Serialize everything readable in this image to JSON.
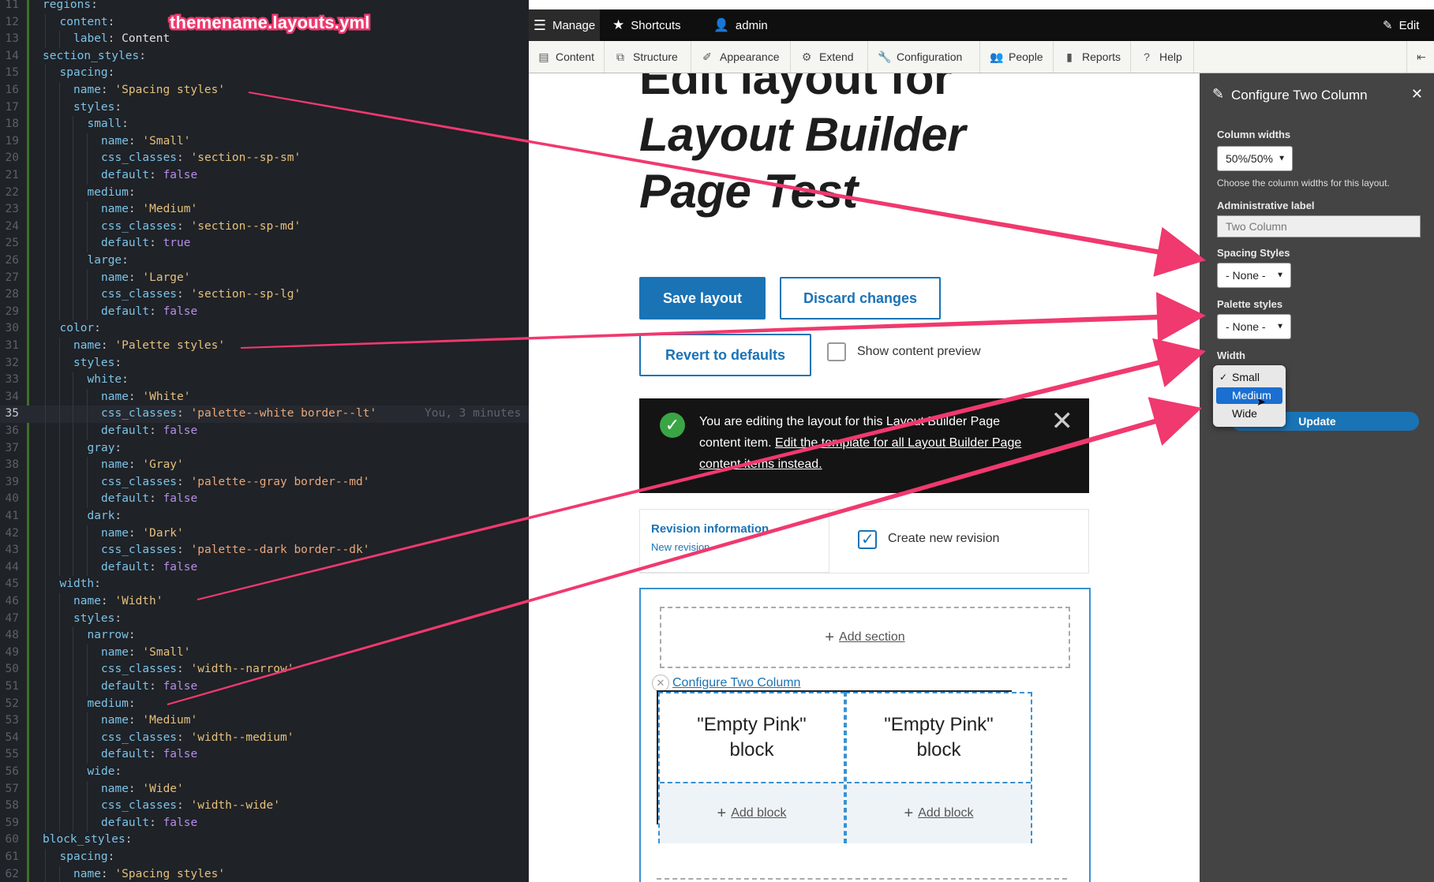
{
  "editor": {
    "file_label": "themename.layouts.yml",
    "blame": "You, 3 minutes",
    "lines": [
      {
        "n": "11",
        "indent": 1,
        "parts": [
          [
            "k",
            "regions"
          ],
          [
            "p",
            ":"
          ]
        ]
      },
      {
        "n": "12",
        "indent": 2,
        "parts": [
          [
            "k",
            "content"
          ],
          [
            "p",
            ":"
          ]
        ]
      },
      {
        "n": "13",
        "indent": 3,
        "parts": [
          [
            "k",
            "label"
          ],
          [
            "p",
            ": "
          ],
          [
            "t",
            "Content"
          ]
        ]
      },
      {
        "n": "14",
        "indent": 1,
        "parts": [
          [
            "k",
            "section_styles"
          ],
          [
            "p",
            ":"
          ]
        ]
      },
      {
        "n": "15",
        "indent": 2,
        "parts": [
          [
            "k",
            "spacing"
          ],
          [
            "p",
            ":"
          ]
        ]
      },
      {
        "n": "16",
        "indent": 3,
        "parts": [
          [
            "k",
            "name"
          ],
          [
            "p",
            ": "
          ],
          [
            "s",
            "'Spacing styles'"
          ]
        ]
      },
      {
        "n": "17",
        "indent": 3,
        "parts": [
          [
            "k",
            "styles"
          ],
          [
            "p",
            ":"
          ]
        ]
      },
      {
        "n": "18",
        "indent": 4,
        "parts": [
          [
            "k",
            "small"
          ],
          [
            "p",
            ":"
          ]
        ]
      },
      {
        "n": "19",
        "indent": 5,
        "parts": [
          [
            "k",
            "name"
          ],
          [
            "p",
            ": "
          ],
          [
            "s",
            "'Small'"
          ]
        ]
      },
      {
        "n": "20",
        "indent": 5,
        "parts": [
          [
            "k",
            "css_classes"
          ],
          [
            "p",
            ": "
          ],
          [
            "s",
            "'section--sp-sm'"
          ]
        ]
      },
      {
        "n": "21",
        "indent": 5,
        "parts": [
          [
            "k",
            "default"
          ],
          [
            "p",
            ": "
          ],
          [
            "b",
            "false"
          ]
        ]
      },
      {
        "n": "22",
        "indent": 4,
        "parts": [
          [
            "k",
            "medium"
          ],
          [
            "p",
            ":"
          ]
        ]
      },
      {
        "n": "23",
        "indent": 5,
        "parts": [
          [
            "k",
            "name"
          ],
          [
            "p",
            ": "
          ],
          [
            "s",
            "'Medium'"
          ]
        ]
      },
      {
        "n": "24",
        "indent": 5,
        "parts": [
          [
            "k",
            "css_classes"
          ],
          [
            "p",
            ": "
          ],
          [
            "s",
            "'section--sp-md'"
          ]
        ]
      },
      {
        "n": "25",
        "indent": 5,
        "parts": [
          [
            "k",
            "default"
          ],
          [
            "p",
            ": "
          ],
          [
            "b",
            "true"
          ]
        ]
      },
      {
        "n": "26",
        "indent": 4,
        "parts": [
          [
            "k",
            "large"
          ],
          [
            "p",
            ":"
          ]
        ]
      },
      {
        "n": "27",
        "indent": 5,
        "parts": [
          [
            "k",
            "name"
          ],
          [
            "p",
            ": "
          ],
          [
            "s",
            "'Large'"
          ]
        ]
      },
      {
        "n": "28",
        "indent": 5,
        "parts": [
          [
            "k",
            "css_classes"
          ],
          [
            "p",
            ": "
          ],
          [
            "s",
            "'section--sp-lg'"
          ]
        ]
      },
      {
        "n": "29",
        "indent": 5,
        "parts": [
          [
            "k",
            "default"
          ],
          [
            "p",
            ": "
          ],
          [
            "b",
            "false"
          ]
        ]
      },
      {
        "n": "30",
        "indent": 2,
        "parts": [
          [
            "k",
            "color"
          ],
          [
            "p",
            ":"
          ]
        ]
      },
      {
        "n": "31",
        "indent": 3,
        "parts": [
          [
            "k",
            "name"
          ],
          [
            "p",
            ": "
          ],
          [
            "s",
            "'Palette styles'"
          ]
        ]
      },
      {
        "n": "32",
        "indent": 3,
        "parts": [
          [
            "k",
            "styles"
          ],
          [
            "p",
            ":"
          ]
        ]
      },
      {
        "n": "33",
        "indent": 4,
        "parts": [
          [
            "k",
            "white"
          ],
          [
            "p",
            ":"
          ]
        ]
      },
      {
        "n": "34",
        "indent": 5,
        "parts": [
          [
            "k",
            "name"
          ],
          [
            "p",
            ": "
          ],
          [
            "s",
            "'White'"
          ]
        ]
      },
      {
        "n": "35",
        "indent": 5,
        "parts": [
          [
            "k",
            "css_classes"
          ],
          [
            "p",
            ": "
          ],
          [
            "s",
            "'"
          ],
          [
            "sv",
            "palette--white border--lt"
          ],
          [
            "s",
            "'"
          ]
        ]
      },
      {
        "n": "36",
        "indent": 5,
        "parts": [
          [
            "k",
            "default"
          ],
          [
            "p",
            ": "
          ],
          [
            "b",
            "false"
          ]
        ]
      },
      {
        "n": "37",
        "indent": 4,
        "parts": [
          [
            "k",
            "gray"
          ],
          [
            "p",
            ":"
          ]
        ]
      },
      {
        "n": "38",
        "indent": 5,
        "parts": [
          [
            "k",
            "name"
          ],
          [
            "p",
            ": "
          ],
          [
            "s",
            "'Gray'"
          ]
        ]
      },
      {
        "n": "39",
        "indent": 5,
        "parts": [
          [
            "k",
            "css_classes"
          ],
          [
            "p",
            ": "
          ],
          [
            "s",
            "'"
          ],
          [
            "sv",
            "palette--gray border--md"
          ],
          [
            "s",
            "'"
          ]
        ]
      },
      {
        "n": "40",
        "indent": 5,
        "parts": [
          [
            "k",
            "default"
          ],
          [
            "p",
            ": "
          ],
          [
            "b",
            "false"
          ]
        ]
      },
      {
        "n": "41",
        "indent": 4,
        "parts": [
          [
            "k",
            "dark"
          ],
          [
            "p",
            ":"
          ]
        ]
      },
      {
        "n": "42",
        "indent": 5,
        "parts": [
          [
            "k",
            "name"
          ],
          [
            "p",
            ": "
          ],
          [
            "s",
            "'Dark'"
          ]
        ]
      },
      {
        "n": "43",
        "indent": 5,
        "parts": [
          [
            "k",
            "css_classes"
          ],
          [
            "p",
            ": "
          ],
          [
            "s",
            "'"
          ],
          [
            "sv",
            "palette--dark border--dk"
          ],
          [
            "s",
            "'"
          ]
        ]
      },
      {
        "n": "44",
        "indent": 5,
        "parts": [
          [
            "k",
            "default"
          ],
          [
            "p",
            ": "
          ],
          [
            "b",
            "false"
          ]
        ]
      },
      {
        "n": "45",
        "indent": 2,
        "parts": [
          [
            "k",
            "width"
          ],
          [
            "p",
            ":"
          ]
        ]
      },
      {
        "n": "46",
        "indent": 3,
        "parts": [
          [
            "k",
            "name"
          ],
          [
            "p",
            ": "
          ],
          [
            "s",
            "'Width'"
          ]
        ]
      },
      {
        "n": "47",
        "indent": 3,
        "parts": [
          [
            "k",
            "styles"
          ],
          [
            "p",
            ":"
          ]
        ]
      },
      {
        "n": "48",
        "indent": 4,
        "parts": [
          [
            "k",
            "narrow"
          ],
          [
            "p",
            ":"
          ]
        ]
      },
      {
        "n": "49",
        "indent": 5,
        "parts": [
          [
            "k",
            "name"
          ],
          [
            "p",
            ": "
          ],
          [
            "s",
            "'Small'"
          ]
        ]
      },
      {
        "n": "50",
        "indent": 5,
        "parts": [
          [
            "k",
            "css_classes"
          ],
          [
            "p",
            ": "
          ],
          [
            "s",
            "'width--narrow'"
          ]
        ]
      },
      {
        "n": "51",
        "indent": 5,
        "parts": [
          [
            "k",
            "default"
          ],
          [
            "p",
            ": "
          ],
          [
            "b",
            "false"
          ]
        ]
      },
      {
        "n": "52",
        "indent": 4,
        "parts": [
          [
            "k",
            "medium"
          ],
          [
            "p",
            ":"
          ]
        ]
      },
      {
        "n": "53",
        "indent": 5,
        "parts": [
          [
            "k",
            "name"
          ],
          [
            "p",
            ": "
          ],
          [
            "s",
            "'Medium'"
          ]
        ]
      },
      {
        "n": "54",
        "indent": 5,
        "parts": [
          [
            "k",
            "css_classes"
          ],
          [
            "p",
            ": "
          ],
          [
            "s",
            "'width--medium'"
          ]
        ]
      },
      {
        "n": "55",
        "indent": 5,
        "parts": [
          [
            "k",
            "default"
          ],
          [
            "p",
            ": "
          ],
          [
            "b",
            "false"
          ]
        ]
      },
      {
        "n": "56",
        "indent": 4,
        "parts": [
          [
            "k",
            "wide"
          ],
          [
            "p",
            ":"
          ]
        ]
      },
      {
        "n": "57",
        "indent": 5,
        "parts": [
          [
            "k",
            "name"
          ],
          [
            "p",
            ": "
          ],
          [
            "s",
            "'Wide'"
          ]
        ]
      },
      {
        "n": "58",
        "indent": 5,
        "parts": [
          [
            "k",
            "css_classes"
          ],
          [
            "p",
            ": "
          ],
          [
            "s",
            "'width--wide'"
          ]
        ]
      },
      {
        "n": "59",
        "indent": 5,
        "parts": [
          [
            "k",
            "default"
          ],
          [
            "p",
            ": "
          ],
          [
            "b",
            "false"
          ]
        ]
      },
      {
        "n": "60",
        "indent": 1,
        "parts": [
          [
            "k",
            "block_styles"
          ],
          [
            "p",
            ":"
          ]
        ]
      },
      {
        "n": "61",
        "indent": 2,
        "parts": [
          [
            "k",
            "spacing"
          ],
          [
            "p",
            ":"
          ]
        ]
      },
      {
        "n": "62",
        "indent": 3,
        "parts": [
          [
            "k",
            "name"
          ],
          [
            "p",
            ": "
          ],
          [
            "s",
            "'Spacing styles'"
          ]
        ]
      }
    ]
  },
  "toolbar": {
    "manage": "Manage",
    "shortcuts": "Shortcuts",
    "user": "admin",
    "edit": "Edit",
    "tray": [
      "Content",
      "Structure",
      "Appearance",
      "Extend",
      "Configuration",
      "People",
      "Reports",
      "Help"
    ]
  },
  "page": {
    "title_line1": "Edit layout for",
    "title_line2": "Layout Builder",
    "title_line3": "Page Test",
    "save_layout": "Save layout",
    "discard_changes": "Discard changes",
    "revert_defaults": "Revert to defaults",
    "show_preview": "Show content preview",
    "message_part1": "You are editing the layout for this Layout Builder Page content item. ",
    "message_link": "Edit the template for all Layout Builder Page content items instead.",
    "revision_title": "Revision information",
    "revision_sub": "New revision",
    "create_revision": "Create new revision",
    "add_section": "Add section",
    "configure_link": "Configure Two Column",
    "block_text": "\"Empty Pink\" block",
    "add_block": "Add block"
  },
  "offcanvas": {
    "title": "Configure Two Column",
    "column_widths_label": "Column widths",
    "column_widths_value": "50%/50%",
    "column_widths_help": "Choose the column widths for this layout.",
    "admin_label": "Administrative label",
    "admin_value": "Two Column",
    "spacing_label": "Spacing Styles",
    "spacing_value": "- None -",
    "palette_label": "Palette styles",
    "palette_value": "- None -",
    "width_label": "Width",
    "width_options": [
      "Small",
      "Medium",
      "Wide"
    ],
    "width_checked": "Small",
    "width_highlighted": "Medium",
    "update": "Update"
  },
  "colors": {
    "annotation": "#f0396e",
    "drupal_blue": "#1a73b5",
    "toolbar_black": "#0f0f0f",
    "offcanvas_bg": "#444444"
  }
}
